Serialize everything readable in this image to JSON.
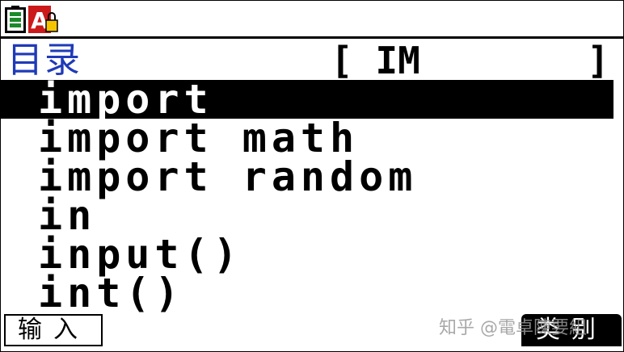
{
  "status_bar": {
    "icons": [
      "battery-icon",
      "alpha-lock-icon"
    ]
  },
  "header": {
    "title": "目录",
    "search_open": "[",
    "search_text": "IM",
    "search_close": "]"
  },
  "catalog": {
    "selected_index": 0,
    "items": [
      {
        "label": "import"
      },
      {
        "label": "import math"
      },
      {
        "label": "import random"
      },
      {
        "label": "in"
      },
      {
        "label": "input()"
      },
      {
        "label": "int()"
      }
    ]
  },
  "softkeys": {
    "f1_label": "输入",
    "f6_label": "类别"
  },
  "watermark": {
    "text": "知乎 @電卓陳要組"
  },
  "colors": {
    "title": "#1f3ab8",
    "highlight": "#000000",
    "battery": "#1a8a2a",
    "alpha_badge": "#cc1a1a"
  }
}
